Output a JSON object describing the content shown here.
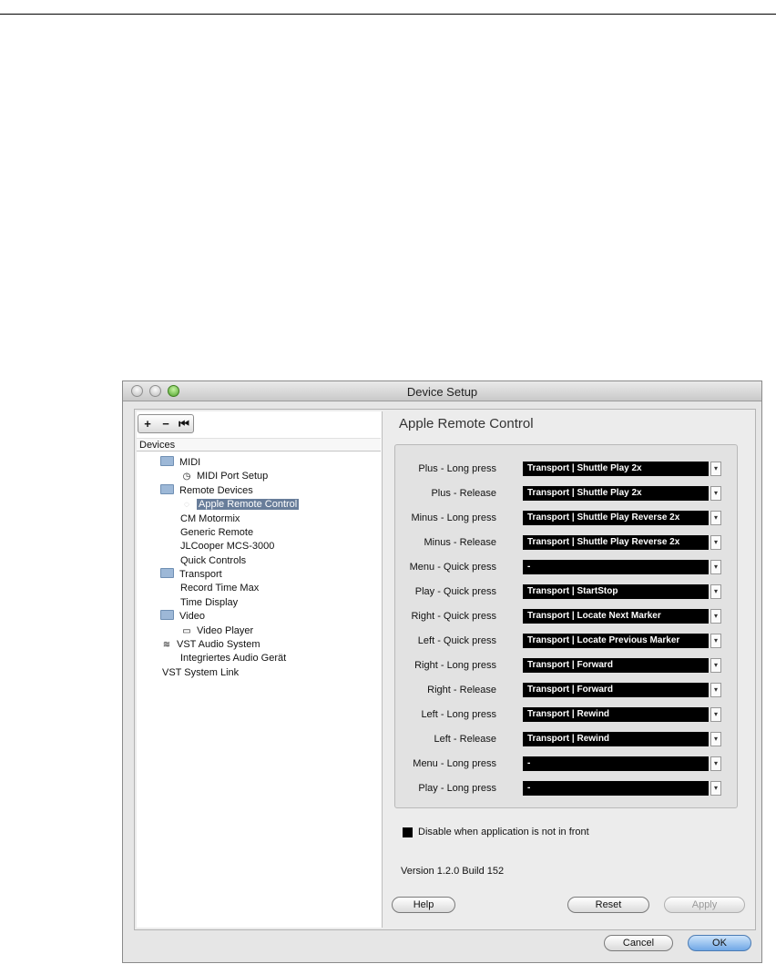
{
  "window": {
    "title": "Device Setup"
  },
  "toolbar": {
    "add": "+",
    "remove": "−",
    "reset": "⏮"
  },
  "devices": {
    "header": "Devices",
    "tree": [
      {
        "label": "MIDI",
        "icon": "folder-icon"
      },
      {
        "label": "MIDI Port Setup",
        "icon": "midi-port-icon"
      },
      {
        "label": "Remote Devices",
        "icon": "folder-icon"
      },
      {
        "label": "Apple Remote Control",
        "icon": "remote-icon",
        "selected": true
      },
      {
        "label": "CM Motormix"
      },
      {
        "label": "Generic Remote"
      },
      {
        "label": "JLCooper MCS-3000"
      },
      {
        "label": "Quick Controls"
      },
      {
        "label": "Transport",
        "icon": "folder-icon"
      },
      {
        "label": "Record Time Max"
      },
      {
        "label": "Time Display"
      },
      {
        "label": "Video",
        "icon": "folder-icon"
      },
      {
        "label": "Video Player",
        "icon": "video-icon"
      },
      {
        "label": "VST Audio System",
        "icon": "vst-audio-icon"
      },
      {
        "label": "Integriertes Audio Gerät"
      },
      {
        "label": "VST System Link"
      }
    ]
  },
  "panel": {
    "title": "Apple Remote Control",
    "mappings": [
      {
        "label": "Plus - Long press",
        "value": "Transport | Shuttle Play 2x"
      },
      {
        "label": "Plus - Release",
        "value": "Transport | Shuttle Play 2x"
      },
      {
        "label": "Minus - Long press",
        "value": "Transport | Shuttle Play Reverse 2x"
      },
      {
        "label": "Minus - Release",
        "value": "Transport | Shuttle Play Reverse 2x"
      },
      {
        "label": "Menu - Quick press",
        "value": "-"
      },
      {
        "label": "Play - Quick press",
        "value": "Transport | StartStop"
      },
      {
        "label": "Right - Quick press",
        "value": "Transport | Locate Next Marker"
      },
      {
        "label": "Left - Quick press",
        "value": "Transport | Locate Previous Marker"
      },
      {
        "label": "Right - Long press",
        "value": "Transport | Forward"
      },
      {
        "label": "Right - Release",
        "value": "Transport | Forward"
      },
      {
        "label": "Left - Long press",
        "value": "Transport | Rewind"
      },
      {
        "label": "Left - Release",
        "value": "Transport | Rewind"
      },
      {
        "label": "Menu - Long press",
        "value": "-"
      },
      {
        "label": "Play - Long press",
        "value": "-"
      }
    ],
    "disable_label": "Disable when application is not in front",
    "disable_checked": true,
    "version": "Version 1.2.0 Build 152"
  },
  "buttons": {
    "help": "Help",
    "reset": "Reset",
    "apply": "Apply",
    "cancel": "Cancel",
    "ok": "OK"
  }
}
